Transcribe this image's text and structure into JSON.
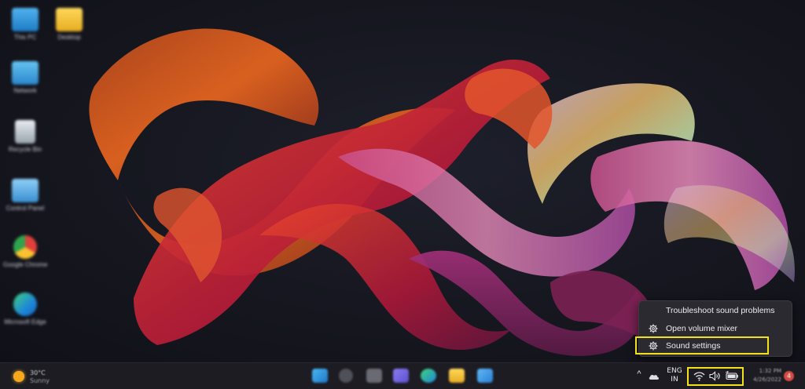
{
  "desktop": {
    "icons": [
      {
        "label": "This PC",
        "icon": "monitor-icon"
      },
      {
        "label": "Desktop",
        "icon": "folder-icon"
      },
      {
        "label": "Network",
        "icon": "network-icon"
      },
      {
        "label": "Recycle Bin",
        "icon": "recycle-bin-icon"
      },
      {
        "label": "Control Panel",
        "icon": "control-panel-icon"
      },
      {
        "label": "Google Chrome",
        "icon": "chrome-icon"
      },
      {
        "label": "Microsoft Edge",
        "icon": "edge-icon"
      }
    ]
  },
  "context_menu": {
    "items": [
      {
        "label": "Troubleshoot sound problems",
        "icon": ""
      },
      {
        "label": "Open volume mixer",
        "icon": "gear-icon"
      },
      {
        "label": "Sound settings",
        "icon": "gear-icon",
        "highlighted": true
      }
    ]
  },
  "taskbar": {
    "weather": {
      "temp": "30°C",
      "condition": "Sunny",
      "icon": "sun-icon"
    },
    "apps": [
      "start-icon",
      "search-icon",
      "task-view-icon",
      "chat-icon",
      "edge-icon",
      "file-explorer-icon",
      "store-icon"
    ],
    "tray": {
      "overflow_chevron": "^",
      "cloud_icon": "onedrive-icon",
      "language_line1": "ENG",
      "language_line2": "IN",
      "wifi_icon": "wifi-icon",
      "volume_icon": "volume-icon",
      "battery_icon": "battery-icon",
      "time": "1:32 PM",
      "date": "4/26/2022",
      "notifications_count": "4"
    }
  },
  "colors": {
    "highlight": "#f3e21b",
    "menu_bg": "#2b2a30",
    "taskbar_bg": "#1d1c22"
  }
}
